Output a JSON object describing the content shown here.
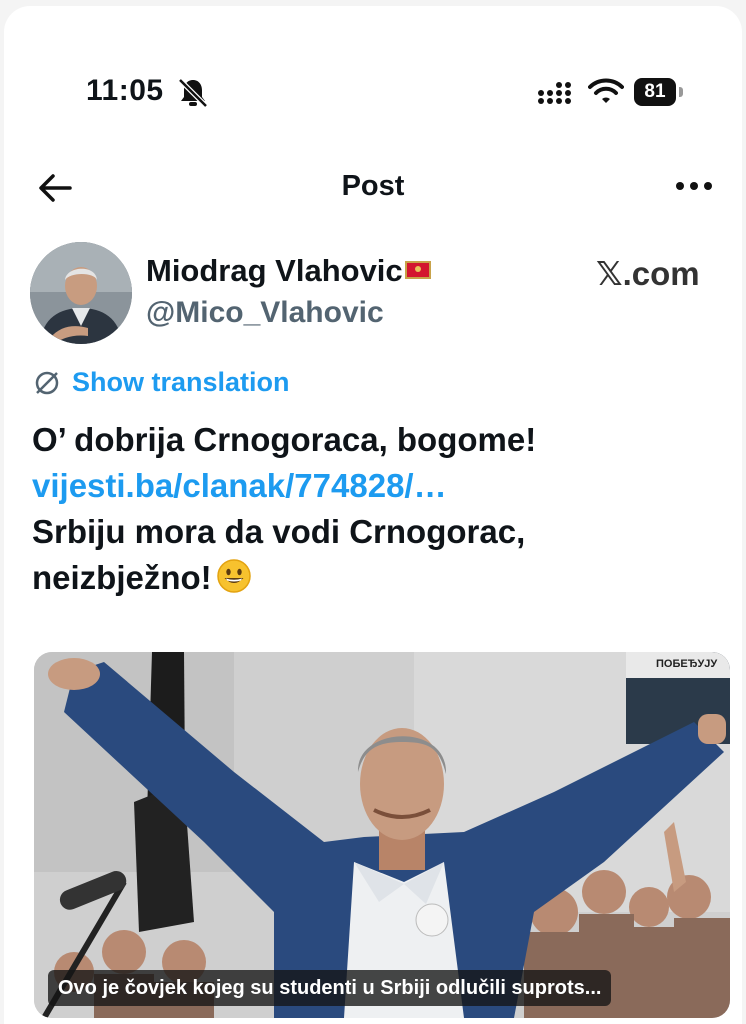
{
  "status": {
    "time": "11:05",
    "battery": "81"
  },
  "header": {
    "title": "Post"
  },
  "author": {
    "name": "Miodrag Vlahovic",
    "handle": "@Mico_Vlahovic"
  },
  "watermark": "𝕏.com",
  "translation": {
    "label": "Show translation"
  },
  "post": {
    "line1": "O’ dobrija Crnogoraca, bogome!",
    "link": "vijesti.ba/clanak/774828/…",
    "line3": "Srbiju mora da vodi Crnogorac,",
    "line4": "neizbježno!"
  },
  "media": {
    "caption": "Ovo je čovjek kojeg su studenti u Srbiji odlučili suprots...",
    "sign_text": "ПОБЕЂУЈУ"
  },
  "colors": {
    "accent": "#1d9bf0",
    "flag_red": "#d3152f"
  }
}
